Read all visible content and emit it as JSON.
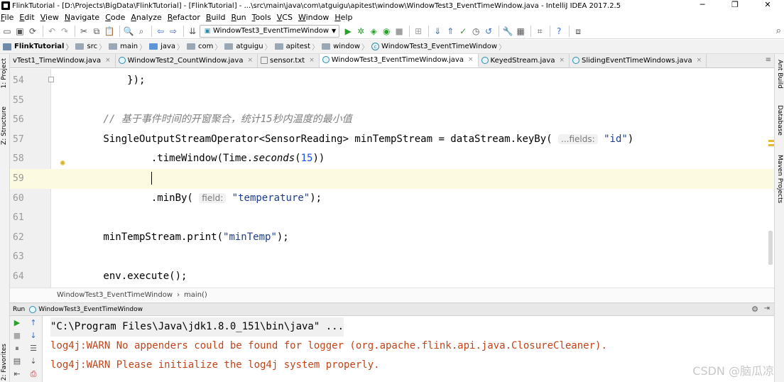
{
  "window": {
    "title": "FlinkTutorial - [D:\\Projects\\BigData\\FlinkTutorial] - [FlinkTutorial] - ...\\src\\main\\java\\com\\atguigu\\apitest\\window\\WindowTest3_EventTimeWindow.java - IntelliJ IDEA 2017.2.5",
    "minimize": "─",
    "maximize": "❐",
    "close": "✕"
  },
  "menu": [
    "File",
    "Edit",
    "View",
    "Navigate",
    "Code",
    "Analyze",
    "Refactor",
    "Build",
    "Run",
    "Tools",
    "VCS",
    "Window",
    "Help"
  ],
  "toolbar": {
    "run_config": "WindowTest3_EventTimeWindow"
  },
  "breadcrumb": [
    "FlinkTutorial",
    "src",
    "main",
    "java",
    "com",
    "atguigu",
    "apitest",
    "window",
    "WindowTest3_EventTimeWindow"
  ],
  "tabs": [
    {
      "label": "vTest1_TimeWindow.java",
      "icon": "class",
      "active": false
    },
    {
      "label": "WindowTest2_CountWindow.java",
      "icon": "class",
      "active": false
    },
    {
      "label": "sensor.txt",
      "icon": "text",
      "active": false
    },
    {
      "label": "WindowTest3_EventTimeWindow.java",
      "icon": "class",
      "active": true
    },
    {
      "label": "KeyedStream.java",
      "icon": "class",
      "active": false
    },
    {
      "label": "SlidingEventTimeWindows.java",
      "icon": "class",
      "active": false
    }
  ],
  "editor": {
    "lines": [
      {
        "num": "54",
        "code": "            });"
      },
      {
        "num": "55",
        "code": ""
      },
      {
        "num": "56",
        "comment": "        // 基于事件时间的开窗聚合，统计15秒内温度的最小值"
      },
      {
        "num": "57",
        "pre": "        SingleOutputStreamOperator<SensorReading> minTempStream = dataStream.keyBy( ",
        "hint": "...fields:",
        "str": " \"id\"",
        "post": ")"
      },
      {
        "num": "58",
        "pre": "                .timeWindow(Time.",
        "ital": "seconds",
        "mid": "(",
        "number": "15",
        "post": "))"
      },
      {
        "num": "59",
        "code": "                "
      },
      {
        "num": "60",
        "pre": "                .minBy( ",
        "hint": "field:",
        "str": " \"temperature\"",
        "post": ");"
      },
      {
        "num": "61",
        "code": ""
      },
      {
        "num": "62",
        "pre": "        minTempStream.print(",
        "str": "\"minTemp\"",
        "post": ");"
      },
      {
        "num": "63",
        "code": ""
      },
      {
        "num": "64",
        "code": "        env.execute();"
      }
    ]
  },
  "editor_crumb": [
    "WindowTest3_EventTimeWindow",
    "›",
    "main()"
  ],
  "run_panel": {
    "label": "Run",
    "config": "WindowTest3_EventTimeWindow",
    "output": [
      {
        "type": "cmd",
        "text": "\"C:\\Program Files\\Java\\jdk1.8.0_151\\bin\\java\" ..."
      },
      {
        "type": "warn",
        "text": "log4j:WARN No appenders could be found for logger (org.apache.flink.api.java.ClosureCleaner)."
      },
      {
        "type": "warn",
        "text": "log4j:WARN Please initialize the log4j system properly."
      }
    ]
  },
  "side_tools": {
    "left": [
      "1: Project",
      "Z: Structure",
      "2: Favorites"
    ],
    "right": [
      "Ant Build",
      "Database",
      "Maven Projects"
    ]
  },
  "watermark": "CSDN @脑瓜凉"
}
